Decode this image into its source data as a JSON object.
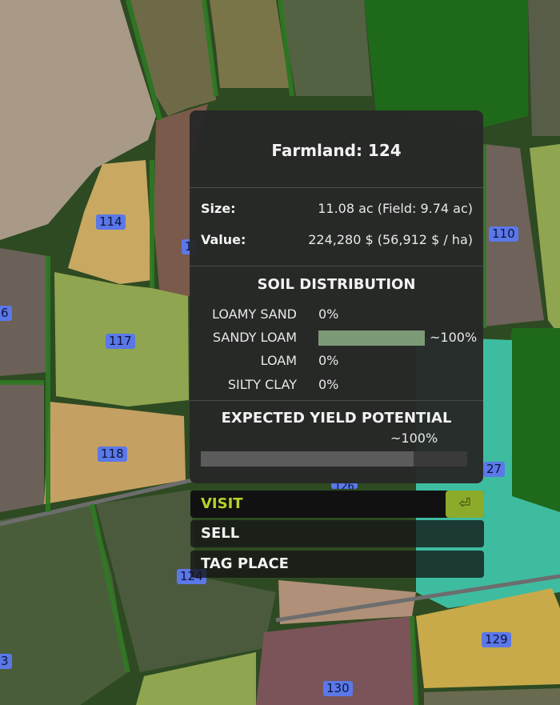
{
  "map": {
    "field_labels": [
      {
        "id": "label-114",
        "text": "114"
      },
      {
        "id": "label-117",
        "text": "117"
      },
      {
        "id": "label-118",
        "text": "118"
      },
      {
        "id": "label-110",
        "text": "110"
      },
      {
        "id": "label-124",
        "text": "124"
      },
      {
        "id": "label-129",
        "text": "129"
      },
      {
        "id": "label-130",
        "text": "130"
      },
      {
        "id": "label-126",
        "text": "126"
      },
      {
        "id": "label-127",
        "text": "27"
      },
      {
        "id": "label-left-6",
        "text": "6"
      },
      {
        "id": "label-left-3",
        "text": "3"
      },
      {
        "id": "label-1",
        "text": "1"
      }
    ]
  },
  "panel": {
    "title": "Farmland: 124",
    "size_label": "Size:",
    "size_value": "11.08 ac (Field: 9.74 ac)",
    "value_label": "Value:",
    "value_value": "224,280 $ (56,912 $ / ha)",
    "soil_title": "SOIL DISTRIBUTION",
    "soils": [
      {
        "name": "LOAMY SAND",
        "pct": "0%",
        "fraction": 0
      },
      {
        "name": "SANDY LOAM",
        "pct": "~100%",
        "fraction": 1.0
      },
      {
        "name": "LOAM",
        "pct": "0%",
        "fraction": 0
      },
      {
        "name": "SILTY CLAY",
        "pct": "0%",
        "fraction": 0
      }
    ],
    "yield_title": "EXPECTED YIELD POTENTIAL",
    "yield_pct": "~100%",
    "yield_fraction": 0.8
  },
  "actions": {
    "visit": "VISIT",
    "sell": "SELL",
    "tag_place": "TAG PLACE",
    "enter_icon": "⏎"
  },
  "colors": {
    "soil_bar": "#7d9a76",
    "visit_text": "#b8d22a",
    "enter_key_bg": "#8cab2a"
  }
}
